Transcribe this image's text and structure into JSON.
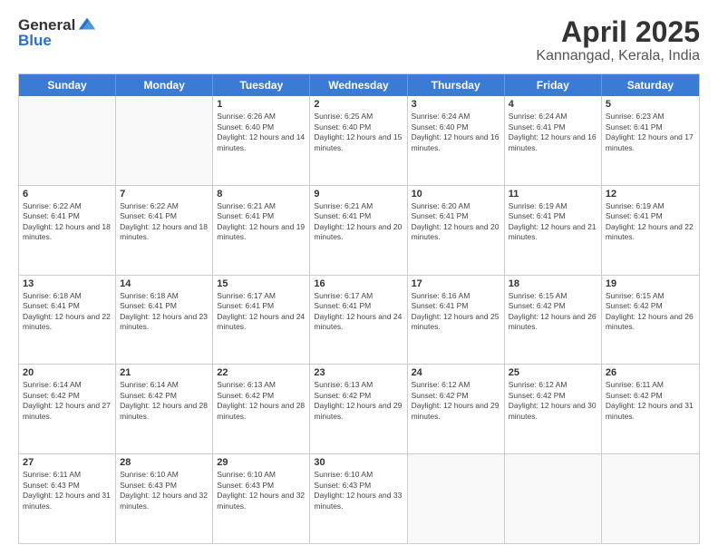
{
  "header": {
    "logo_general": "General",
    "logo_blue": "Blue",
    "title": "April 2025",
    "subtitle": "Kannangad, Kerala, India"
  },
  "calendar": {
    "days_of_week": [
      "Sunday",
      "Monday",
      "Tuesday",
      "Wednesday",
      "Thursday",
      "Friday",
      "Saturday"
    ],
    "weeks": [
      [
        {
          "day": "",
          "info": ""
        },
        {
          "day": "",
          "info": ""
        },
        {
          "day": "1",
          "info": "Sunrise: 6:26 AM\nSunset: 6:40 PM\nDaylight: 12 hours and 14 minutes."
        },
        {
          "day": "2",
          "info": "Sunrise: 6:25 AM\nSunset: 6:40 PM\nDaylight: 12 hours and 15 minutes."
        },
        {
          "day": "3",
          "info": "Sunrise: 6:24 AM\nSunset: 6:40 PM\nDaylight: 12 hours and 16 minutes."
        },
        {
          "day": "4",
          "info": "Sunrise: 6:24 AM\nSunset: 6:41 PM\nDaylight: 12 hours and 16 minutes."
        },
        {
          "day": "5",
          "info": "Sunrise: 6:23 AM\nSunset: 6:41 PM\nDaylight: 12 hours and 17 minutes."
        }
      ],
      [
        {
          "day": "6",
          "info": "Sunrise: 6:22 AM\nSunset: 6:41 PM\nDaylight: 12 hours and 18 minutes."
        },
        {
          "day": "7",
          "info": "Sunrise: 6:22 AM\nSunset: 6:41 PM\nDaylight: 12 hours and 18 minutes."
        },
        {
          "day": "8",
          "info": "Sunrise: 6:21 AM\nSunset: 6:41 PM\nDaylight: 12 hours and 19 minutes."
        },
        {
          "day": "9",
          "info": "Sunrise: 6:21 AM\nSunset: 6:41 PM\nDaylight: 12 hours and 20 minutes."
        },
        {
          "day": "10",
          "info": "Sunrise: 6:20 AM\nSunset: 6:41 PM\nDaylight: 12 hours and 20 minutes."
        },
        {
          "day": "11",
          "info": "Sunrise: 6:19 AM\nSunset: 6:41 PM\nDaylight: 12 hours and 21 minutes."
        },
        {
          "day": "12",
          "info": "Sunrise: 6:19 AM\nSunset: 6:41 PM\nDaylight: 12 hours and 22 minutes."
        }
      ],
      [
        {
          "day": "13",
          "info": "Sunrise: 6:18 AM\nSunset: 6:41 PM\nDaylight: 12 hours and 22 minutes."
        },
        {
          "day": "14",
          "info": "Sunrise: 6:18 AM\nSunset: 6:41 PM\nDaylight: 12 hours and 23 minutes."
        },
        {
          "day": "15",
          "info": "Sunrise: 6:17 AM\nSunset: 6:41 PM\nDaylight: 12 hours and 24 minutes."
        },
        {
          "day": "16",
          "info": "Sunrise: 6:17 AM\nSunset: 6:41 PM\nDaylight: 12 hours and 24 minutes."
        },
        {
          "day": "17",
          "info": "Sunrise: 6:16 AM\nSunset: 6:41 PM\nDaylight: 12 hours and 25 minutes."
        },
        {
          "day": "18",
          "info": "Sunrise: 6:15 AM\nSunset: 6:42 PM\nDaylight: 12 hours and 26 minutes."
        },
        {
          "day": "19",
          "info": "Sunrise: 6:15 AM\nSunset: 6:42 PM\nDaylight: 12 hours and 26 minutes."
        }
      ],
      [
        {
          "day": "20",
          "info": "Sunrise: 6:14 AM\nSunset: 6:42 PM\nDaylight: 12 hours and 27 minutes."
        },
        {
          "day": "21",
          "info": "Sunrise: 6:14 AM\nSunset: 6:42 PM\nDaylight: 12 hours and 28 minutes."
        },
        {
          "day": "22",
          "info": "Sunrise: 6:13 AM\nSunset: 6:42 PM\nDaylight: 12 hours and 28 minutes."
        },
        {
          "day": "23",
          "info": "Sunrise: 6:13 AM\nSunset: 6:42 PM\nDaylight: 12 hours and 29 minutes."
        },
        {
          "day": "24",
          "info": "Sunrise: 6:12 AM\nSunset: 6:42 PM\nDaylight: 12 hours and 29 minutes."
        },
        {
          "day": "25",
          "info": "Sunrise: 6:12 AM\nSunset: 6:42 PM\nDaylight: 12 hours and 30 minutes."
        },
        {
          "day": "26",
          "info": "Sunrise: 6:11 AM\nSunset: 6:42 PM\nDaylight: 12 hours and 31 minutes."
        }
      ],
      [
        {
          "day": "27",
          "info": "Sunrise: 6:11 AM\nSunset: 6:43 PM\nDaylight: 12 hours and 31 minutes."
        },
        {
          "day": "28",
          "info": "Sunrise: 6:10 AM\nSunset: 6:43 PM\nDaylight: 12 hours and 32 minutes."
        },
        {
          "day": "29",
          "info": "Sunrise: 6:10 AM\nSunset: 6:43 PM\nDaylight: 12 hours and 32 minutes."
        },
        {
          "day": "30",
          "info": "Sunrise: 6:10 AM\nSunset: 6:43 PM\nDaylight: 12 hours and 33 minutes."
        },
        {
          "day": "",
          "info": ""
        },
        {
          "day": "",
          "info": ""
        },
        {
          "day": "",
          "info": ""
        }
      ]
    ]
  }
}
